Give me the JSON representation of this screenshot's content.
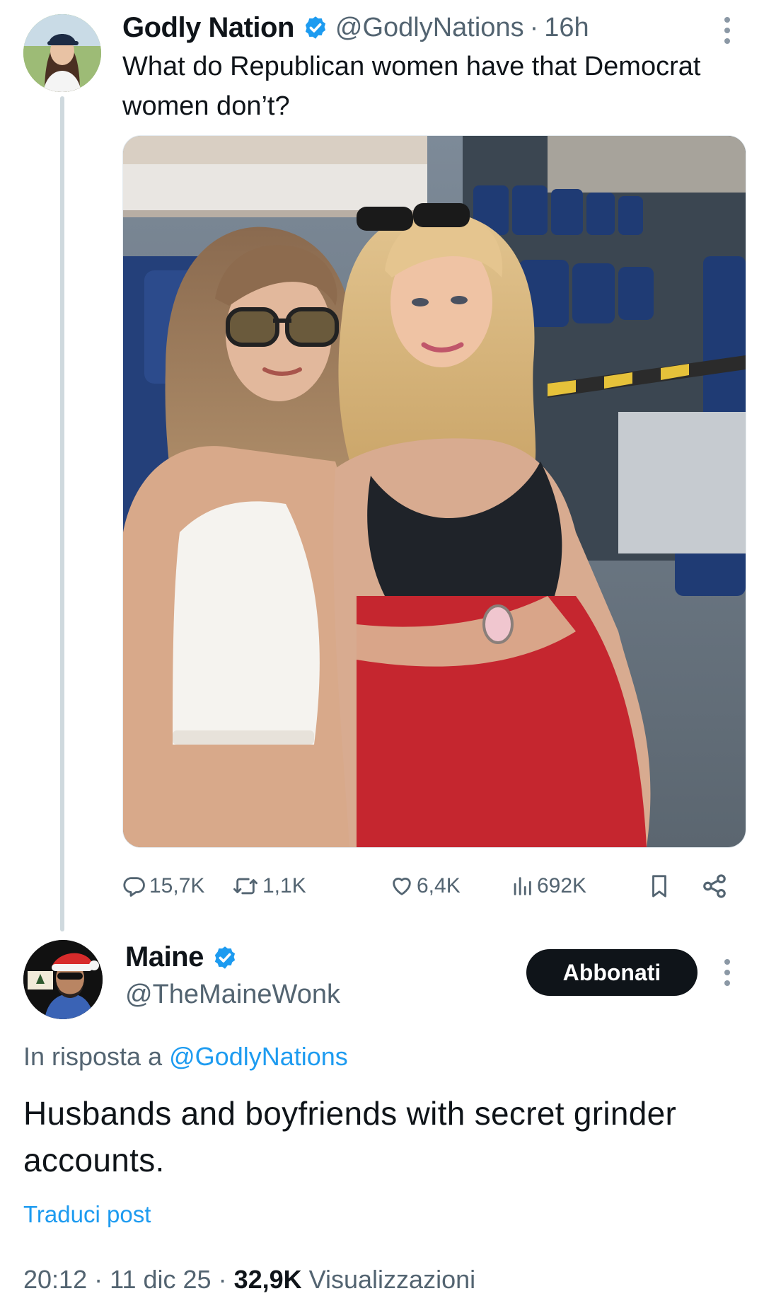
{
  "tweet": {
    "author_name": "Godly Nation",
    "handle": "@GodlyNations",
    "separator": "·",
    "time_ago": "16h",
    "text": "What do Republican women have that Democrat women don’t?",
    "stats": {
      "replies": "15,7K",
      "reposts": "1,1K",
      "likes": "6,4K",
      "views": "692K"
    }
  },
  "reply": {
    "author_name": "Maine",
    "handle": "@TheMaineWonk",
    "subscribe_label": "Abbonati",
    "reply_to_prefix": "In risposta a",
    "reply_to_handle": "@GodlyNations",
    "text": "Husbands and boyfriends with secret grinder accounts.",
    "translate_label": "Traduci post",
    "time": "20:12",
    "date": "11 dic 25",
    "views_count": "32,9K",
    "views_label": "Visualizzazioni"
  },
  "colors": {
    "accent": "#1d9bf0",
    "secondary_text": "#536471",
    "primary_text": "#0f1419",
    "button_bg": "#0f1419"
  },
  "icons": [
    "verified-badge-icon",
    "more-icon",
    "reply-icon",
    "repost-icon",
    "like-icon",
    "views-icon",
    "bookmark-icon",
    "share-icon"
  ]
}
